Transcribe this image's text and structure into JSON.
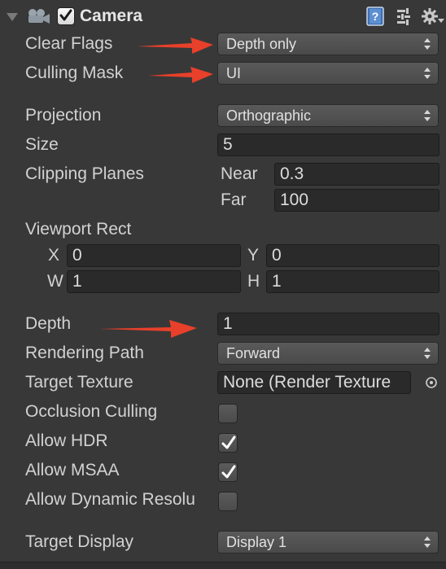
{
  "header": {
    "component_title": "Camera",
    "enabled": true
  },
  "fields": {
    "clear_flags": {
      "label": "Clear Flags",
      "value": "Depth only"
    },
    "culling_mask": {
      "label": "Culling Mask",
      "value": "UI"
    },
    "projection": {
      "label": "Projection",
      "value": "Orthographic"
    },
    "size": {
      "label": "Size",
      "value": "5"
    },
    "clipping_planes": {
      "label": "Clipping Planes",
      "near_label": "Near",
      "near_value": "0.3",
      "far_label": "Far",
      "far_value": "100"
    },
    "viewport_rect": {
      "label": "Viewport Rect",
      "x_label": "X",
      "x_value": "0",
      "y_label": "Y",
      "y_value": "0",
      "w_label": "W",
      "w_value": "1",
      "h_label": "H",
      "h_value": "1"
    },
    "depth": {
      "label": "Depth",
      "value": "1"
    },
    "rendering_path": {
      "label": "Rendering Path",
      "value": "Forward"
    },
    "target_texture": {
      "label": "Target Texture",
      "value": "None (Render Texture"
    },
    "occlusion_culling": {
      "label": "Occlusion Culling",
      "checked": false
    },
    "allow_hdr": {
      "label": "Allow HDR",
      "checked": true
    },
    "allow_msaa": {
      "label": "Allow MSAA",
      "checked": true
    },
    "allow_dynamic_resolution": {
      "label": "Allow Dynamic Resolu",
      "checked": false
    },
    "target_display": {
      "label": "Target Display",
      "value": "Display 1"
    }
  },
  "icons": {
    "foldout": "triangle-down-icon",
    "component": "camera-icon",
    "help": "help-book-icon",
    "presets": "presets-sliders-icon",
    "settings": "gear-icon",
    "object_picker": "object-picker-icon",
    "annotation": "red-arrow-icon"
  },
  "colors": {
    "background": "#383838",
    "field": "#2a2a2a",
    "annotation_arrow": "#e8402a",
    "checkmark": "#ffffff"
  }
}
